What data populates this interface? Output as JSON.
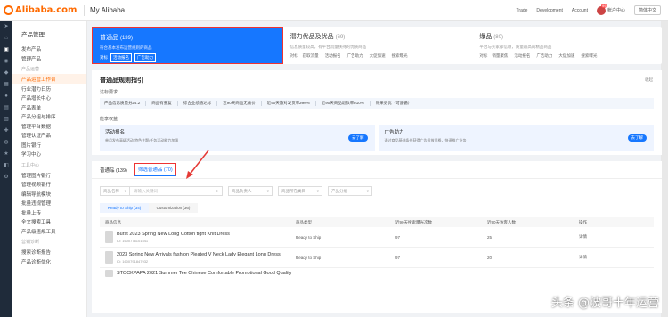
{
  "topbar": {
    "logo": "Alibaba.com",
    "title": "My Alibaba",
    "links": [
      "Trade",
      "Development",
      "Account"
    ],
    "account": "帐户中心",
    "badge": "99",
    "language": "简体中文"
  },
  "iconbar": {
    "icons": [
      "send-icon",
      "home-icon",
      "box-icon",
      "shop-icon",
      "tag-icon",
      "grid-icon",
      "users-icon",
      "chart-icon",
      "doc-icon",
      "gift-icon",
      "cart-icon",
      "star-icon",
      "book-icon",
      "setting-icon"
    ]
  },
  "sidebar": {
    "title": "产品管理",
    "items_top": [
      "发布产品",
      "管理产品"
    ],
    "group1": "产品运营",
    "items_group1": [
      "产品运营工作台",
      "行业潜力日历",
      "产品增长中心",
      "产品表单",
      "产品分组与排序",
      "管理平台数据",
      "管理认证产品",
      "图片银行",
      "学习中心"
    ],
    "group2": "工具中心",
    "items_group2": [
      "管理图片银行",
      "管理视频银行",
      "编辑导航模块",
      "批量违规管理",
      "批量上传",
      "全文搜索工具",
      "产品级违规工具"
    ],
    "group3": "营销诊断",
    "items_group3": [
      "搜索诊断报告",
      "产品诊断优化"
    ]
  },
  "cards": [
    {
      "title": "普通品",
      "count": "(139)",
      "desc": "符合基本发布运营规则的商品",
      "prefix": "对标",
      "tags": [
        "活动报名",
        "广告助力"
      ]
    },
    {
      "title": "潜力优品及优品",
      "count": "(69)",
      "desc": "信息质量较高，有平台流量扶持的优质商品",
      "prefix": "对标",
      "tags": [
        "获取流量",
        "活动报名",
        "广告助力",
        "大促加速",
        "搜索曝光"
      ]
    },
    {
      "title": "爆品",
      "count": "(80)",
      "desc": "平台与买家都信赖，质量最高的精品商品",
      "prefix": "对标",
      "tags": [
        "销量聚焦",
        "活动报名",
        "广告助力",
        "大促加速",
        "搜索曝光"
      ]
    }
  ],
  "rules": {
    "title": "普通品规则指引",
    "collapse": "收起",
    "req_label": "达标要求",
    "requirements": [
      "产品信息质量分≥4.2",
      "商品有重复",
      "综合业绩值达标",
      "近90天商品无偷价",
      "近90天旅对发货率≥90%",
      "近90天商品退款率≥10%",
      "效果更优（可遵循）"
    ],
    "rights_label": "能享权益",
    "rights": [
      {
        "title": "活动报名",
        "desc": "单月发布高级活动/特色主题/任务活动能力加强",
        "button": "去了解"
      },
      {
        "title": "广告助力",
        "desc": "通过商品基础条件获得广告投放资格，快速推广业务",
        "button": "去了解"
      }
    ]
  },
  "list": {
    "tabs": [
      {
        "label": "普通品 (139)"
      },
      {
        "label": "筛选普通品 (70)"
      }
    ],
    "filters": {
      "search_scope": "商品名称",
      "search_placeholder": "请输入关键词",
      "owner": "商品负责人",
      "category": "商品所在类目",
      "group": "产品分组"
    },
    "subtabs": [
      "Ready to Ship (34)",
      "Customization (36)"
    ],
    "headers": [
      "商品信息",
      "商品类型",
      "近90天搜索曝光次数",
      "近90天访客人数",
      "操作"
    ],
    "rows": [
      {
        "name": "Burst 2023 Spring New Long Cotton tight Knit Dress",
        "id": "ID: 1600776101541",
        "type": "Ready to Ship",
        "exposure": "97",
        "visitors": "25",
        "action": "详情"
      },
      {
        "name": "2023 Spring New Arrivals fashion Pleated V Neck Lady Elegant Long Dress",
        "id": "ID: 1600791847932",
        "type": "Ready to Ship",
        "exposure": "97",
        "visitors": "20",
        "action": "详情"
      },
      {
        "name": "STOCKPAPA 2021 Summer Tee Chinese Comfortable Promotional Good Quality",
        "id": "",
        "type": "",
        "exposure": "",
        "visitors": "",
        "action": ""
      }
    ]
  },
  "watermark": "头条 @波哥十年运营"
}
